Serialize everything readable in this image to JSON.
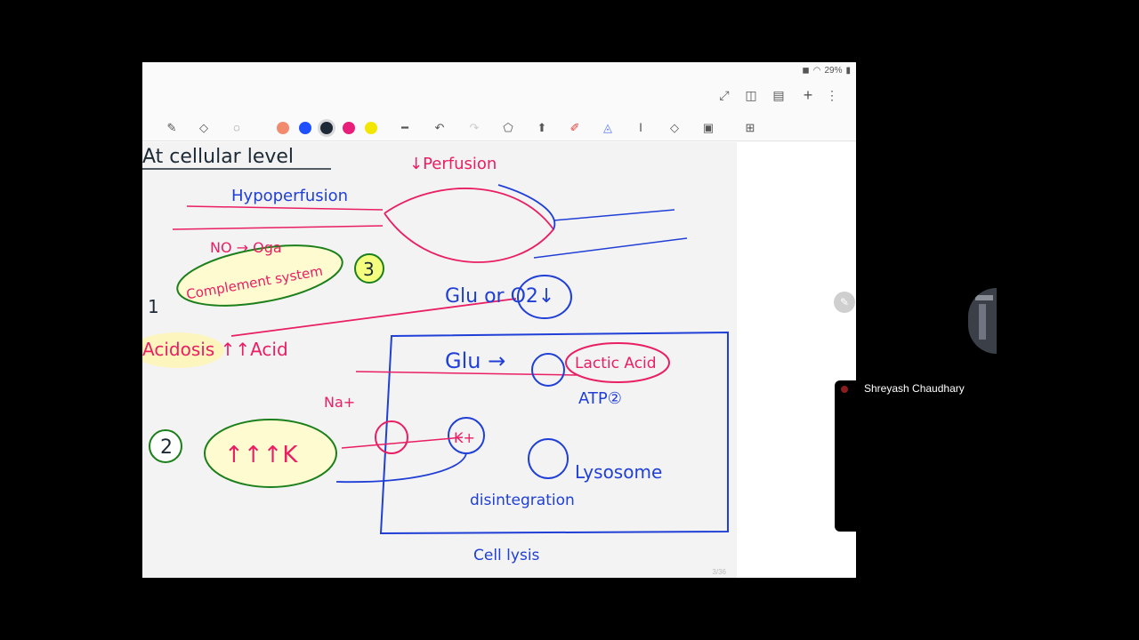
{
  "status": {
    "battery": "29%"
  },
  "topbar": {
    "icons": [
      "expand-icon",
      "split-view-icon",
      "bookmark-icon",
      "add-icon",
      "more-icon"
    ]
  },
  "toolbar": {
    "tools": [
      "pen-icon",
      "eraser-icon",
      "lasso-icon",
      "line-icon",
      "undo-icon",
      "redo-icon",
      "shape-icon",
      "highlighter-icon",
      "marker-icon",
      "laser-icon",
      "text-icon",
      "sticker-icon",
      "image-icon",
      "grid-icon"
    ],
    "colors": [
      "#f28b6e",
      "#1f4fff",
      "#1d2a36",
      "#e91e7a",
      "#f3e600"
    ]
  },
  "notes": {
    "heading": "At cellular level",
    "hypoperfusion": "Hypoperfusion",
    "perfusion": "↓Perfusion",
    "glu_o2": "Glu or O2↓",
    "no_oga": "NO → Oga",
    "complement": "Complement system",
    "num3": "3",
    "num1": "1",
    "acidosis": "Acidosis ↑↑Acid",
    "glu": "Glu →",
    "lactic": "Lactic Acid",
    "atp": "ATP②",
    "na": "Na+",
    "k": "K+",
    "num2": "2",
    "kk": "↑↑↑K",
    "lysosome": "Lysosome",
    "disintegration": "disintegration",
    "cell_lysis": "Cell lysis"
  },
  "page": {
    "number": "3/36"
  },
  "participant": {
    "name": "Shreyash Chaudhary"
  }
}
